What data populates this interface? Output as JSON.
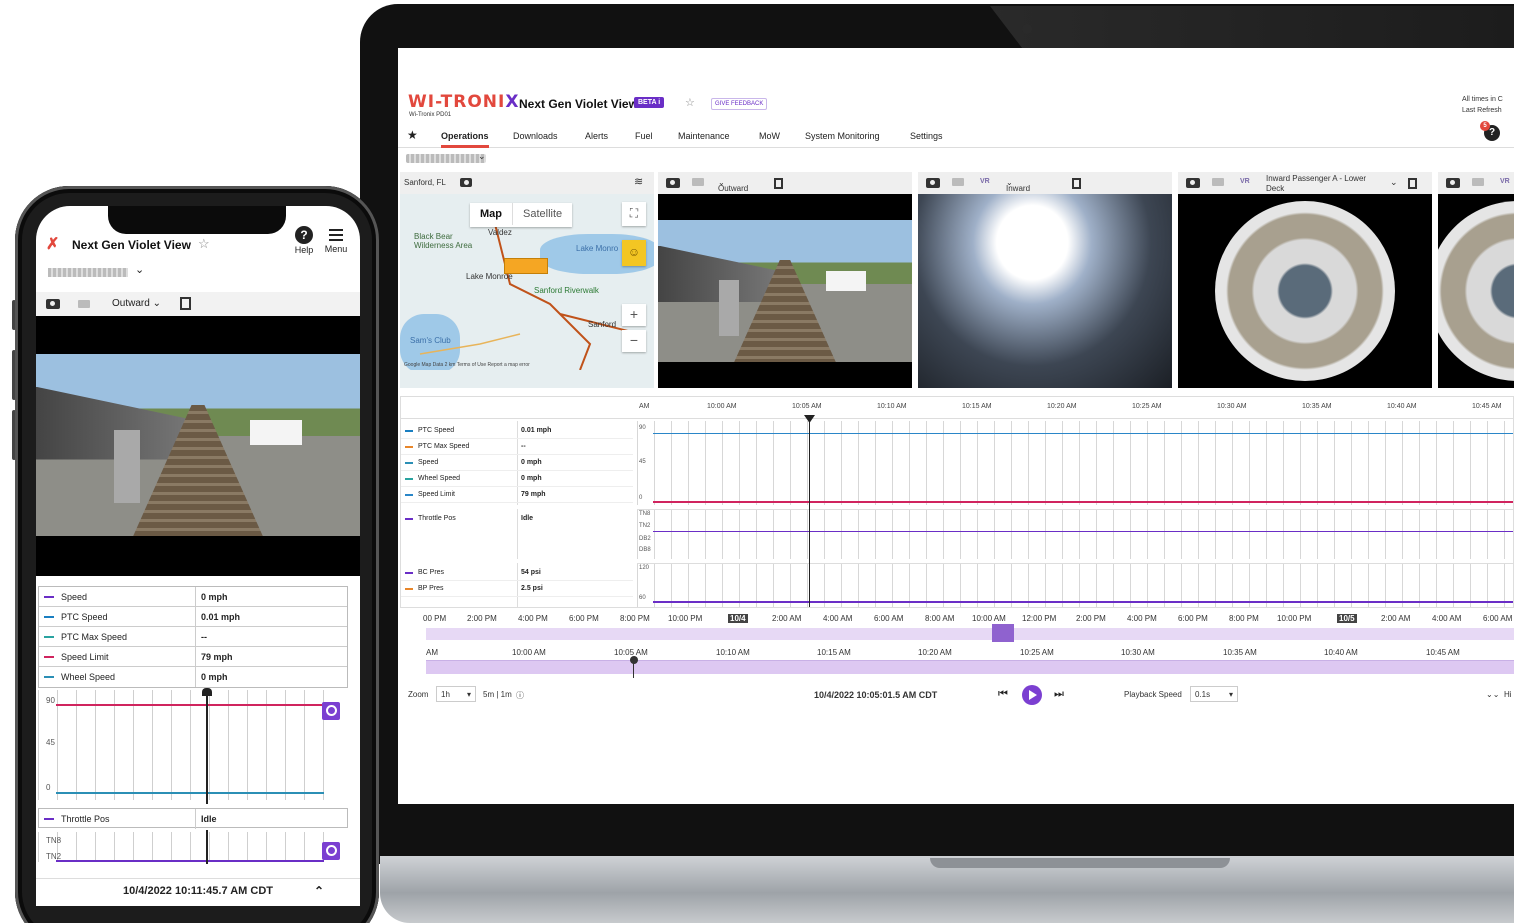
{
  "laptop": {
    "logo_text": "WI-TRONI",
    "logo_x": "X",
    "logo_sub": "Wi-Tronix PD01",
    "app_title": "Next Gen Violet View",
    "beta": "BETA",
    "beta_info": "i",
    "star": "☆",
    "feedback": "GIVE FEEDBACK",
    "times_note_1": "All times in C",
    "times_note_2": "Last Refresh",
    "nav": {
      "star": "★",
      "items": [
        "Operations",
        "Downloads",
        "Alerts",
        "Fuel",
        "Maintenance",
        "MoW",
        "System Monitoring",
        "Settings"
      ],
      "active": "Operations"
    },
    "notifications": {
      "icon": "?",
      "count": "5"
    },
    "vehicle_chevron": "⌄",
    "map_panel": {
      "location": "Sanford, FL",
      "tabs": [
        "Map",
        "Satellite"
      ],
      "labels": [
        "Valdez",
        "Black Bear Wilderness Area",
        "Lake Monro",
        "Lake Monroe",
        "Sanford Riverwalk",
        "Sanford",
        "Sam's Club"
      ],
      "zoom_in": "+",
      "zoom_out": "−",
      "footer": "Google  Map Data  2 km  Terms of Use  Report a map error"
    },
    "cameras": [
      {
        "name": "Outward"
      },
      {
        "name": "Inward Cab",
        "vr": "VR"
      },
      {
        "name": "Inward Passenger A - Lower Deck",
        "vr": "VR"
      },
      {
        "vr": "VR"
      }
    ],
    "timeline": {
      "ticks": [
        "AM",
        "10:00 AM",
        "10:05 AM",
        "10:10 AM",
        "10:15 AM",
        "10:20 AM",
        "10:25 AM",
        "10:30 AM",
        "10:35 AM",
        "10:40 AM",
        "10:45 AM"
      ],
      "speed_rows": [
        {
          "name": "PTC Speed",
          "value": "0.01 mph",
          "color": "#1a7fc1"
        },
        {
          "name": "PTC Max Speed",
          "value": "--",
          "color": "#e8862a"
        },
        {
          "name": "Speed",
          "value": "0 mph",
          "color": "#2b8fb5"
        },
        {
          "name": "Wheel Speed",
          "value": "0 mph",
          "color": "#2aa3a0"
        },
        {
          "name": "Speed Limit",
          "value": "79 mph",
          "color": "#2a86c8"
        }
      ],
      "speed_y": [
        "90",
        "45",
        "0"
      ],
      "throttle_row": {
        "name": "Throttle Pos",
        "value": "Idle",
        "color": "#6a2ec6"
      },
      "throttle_y": [
        "TN8",
        "TN2",
        "DB2",
        "DB8"
      ],
      "brake_rows": [
        {
          "name": "BC Pres",
          "value": "54 psi",
          "color": "#6a2ec6"
        },
        {
          "name": "BP Pres",
          "value": "2.5 psi",
          "color": "#e8862a"
        }
      ],
      "brake_y": [
        "120",
        "60"
      ]
    },
    "overview_ticks": [
      "00 PM",
      "2:00 PM",
      "4:00 PM",
      "6:00 PM",
      "8:00 PM",
      "10:00 PM",
      "10/4",
      "2:00 AM",
      "4:00 AM",
      "6:00 AM",
      "8:00 AM",
      "10:00 AM",
      "12:00 PM",
      "2:00 PM",
      "4:00 PM",
      "6:00 PM",
      "8:00 PM",
      "10:00 PM",
      "10/5",
      "2:00 AM",
      "4:00 AM",
      "6:00 AM"
    ],
    "zoom_ticks": [
      "AM",
      "10:00 AM",
      "10:05 AM",
      "10:10 AM",
      "10:15 AM",
      "10:20 AM",
      "10:25 AM",
      "10:30 AM",
      "10:35 AM",
      "10:40 AM",
      "10:45 AM"
    ],
    "controls": {
      "zoom_label": "Zoom",
      "zoom_value": "1h",
      "zoom_steps": "5m | 1m",
      "info": "ⓘ",
      "timestamp": "10/4/2022 10:05:01.5 AM CDT",
      "prev": "⏮",
      "next": "⏭",
      "playback_label": "Playback Speed",
      "playback_value": "0.1s",
      "collapse": "⌄⌄",
      "hide": "Hi"
    }
  },
  "phone": {
    "app_title": "Next Gen Violet View",
    "star": "☆",
    "help": "Help",
    "help_icon": "?",
    "menu": "Menu",
    "chevron": "⌄",
    "camera": "Outward",
    "stats": [
      {
        "name": "Speed",
        "value": "0 mph",
        "color": "#6a2ec6"
      },
      {
        "name": "PTC Speed",
        "value": "0.01 mph",
        "color": "#1a7fc1"
      },
      {
        "name": "PTC Max Speed",
        "value": "--",
        "color": "#2aa3a0"
      },
      {
        "name": "Speed Limit",
        "value": "79 mph",
        "color": "#d0245e"
      },
      {
        "name": "Wheel Speed",
        "value": "0 mph",
        "color": "#2b8fb5"
      }
    ],
    "chart_y": [
      "90",
      "45",
      "0"
    ],
    "throttle": {
      "name": "Throttle Pos",
      "value": "Idle",
      "color": "#6a2ec6"
    },
    "throttle_y": [
      "TN8",
      "TN2"
    ],
    "timestamp": "10/4/2022 10:11:45.7 AM CDT",
    "expand": "⌃"
  },
  "colors": {
    "accent": "#6a2ec6",
    "brand_red": "#e2483d",
    "speed_limit": "#d0245e",
    "speed_line": "#2a86c8"
  }
}
